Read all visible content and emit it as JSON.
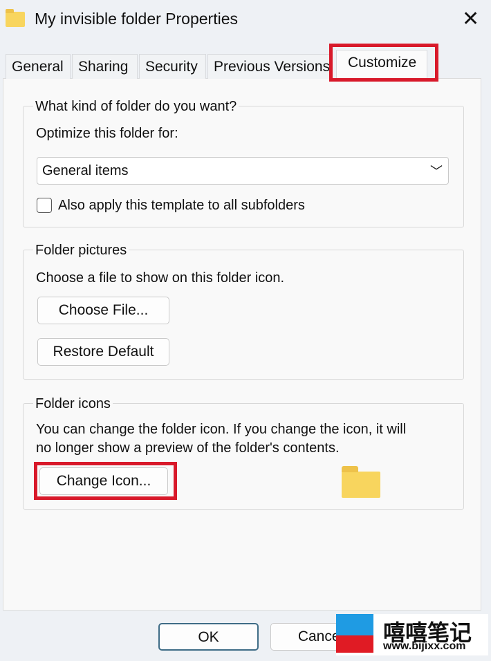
{
  "window": {
    "title": "My invisible folder Properties",
    "close_icon": "close-icon"
  },
  "tabs": [
    {
      "label": "General"
    },
    {
      "label": "Sharing"
    },
    {
      "label": "Security"
    },
    {
      "label": "Previous Versions"
    },
    {
      "label": "Customize",
      "active": true
    }
  ],
  "group_kind": {
    "label": "What kind of folder do you want?",
    "optimize_label": "Optimize this folder for:",
    "select_value": "General items",
    "checkbox_label": "Also apply this template to all subfolders",
    "checkbox_checked": false
  },
  "group_pictures": {
    "label": "Folder pictures",
    "description": "Choose a file to show on this folder icon.",
    "choose_file": "Choose File...",
    "restore_default": "Restore Default"
  },
  "group_icons": {
    "label": "Folder icons",
    "description_line1": "You can change the folder icon. If you change the icon, it will",
    "description_line2": "no longer show a preview of the folder's contents.",
    "change_icon": "Change Icon..."
  },
  "footer": {
    "ok": "OK",
    "cancel": "Cancel"
  },
  "watermark": {
    "name": "嘻嘻笔记",
    "url": "www.bijixx.com"
  },
  "colors": {
    "highlight": "#d8192a",
    "folder": "#f8d55e"
  }
}
